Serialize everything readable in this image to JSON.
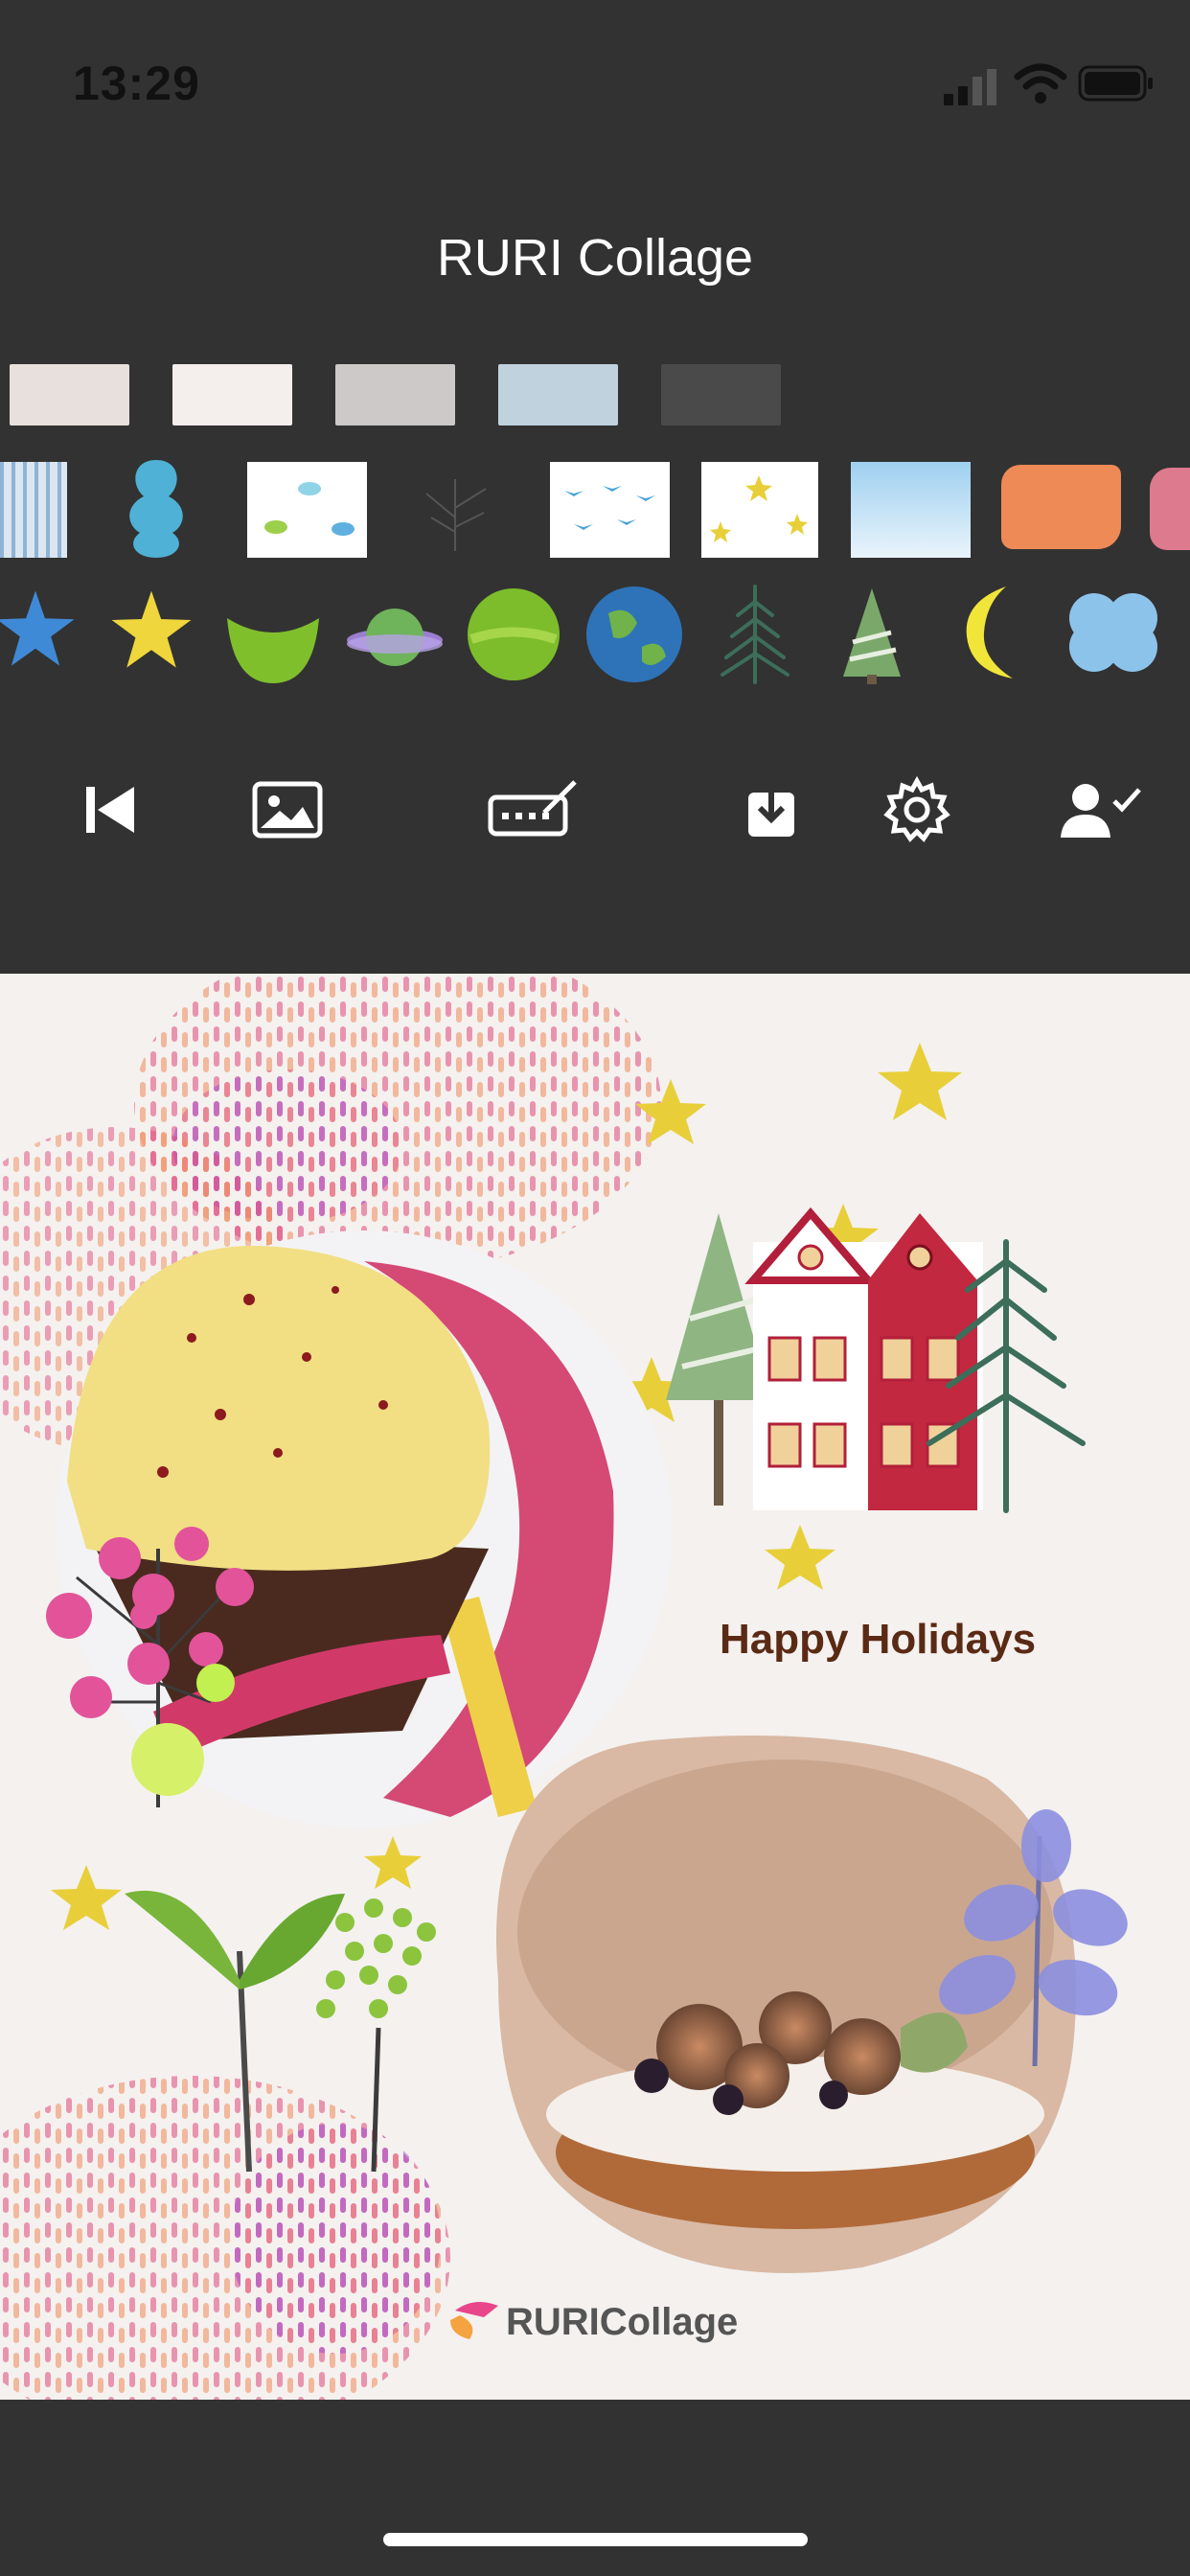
{
  "status_bar": {
    "time": "13:29"
  },
  "header": {
    "title": "RURI Collage"
  },
  "background_swatches": [
    "#e9e1de",
    "#f4efee",
    "#cfcbcb",
    "#c0d3df",
    "#4a4a4a"
  ],
  "toolbar": {
    "icons": [
      "skip-back-icon",
      "image-icon",
      "keyboard-edit-icon",
      "download-icon",
      "gear-icon",
      "user-check-icon"
    ]
  },
  "canvas": {
    "greeting": "Happy Holidays",
    "brand": "RURICollage",
    "colors": {
      "greeting": "#5a2a14",
      "star": "#e8cf3a"
    }
  }
}
